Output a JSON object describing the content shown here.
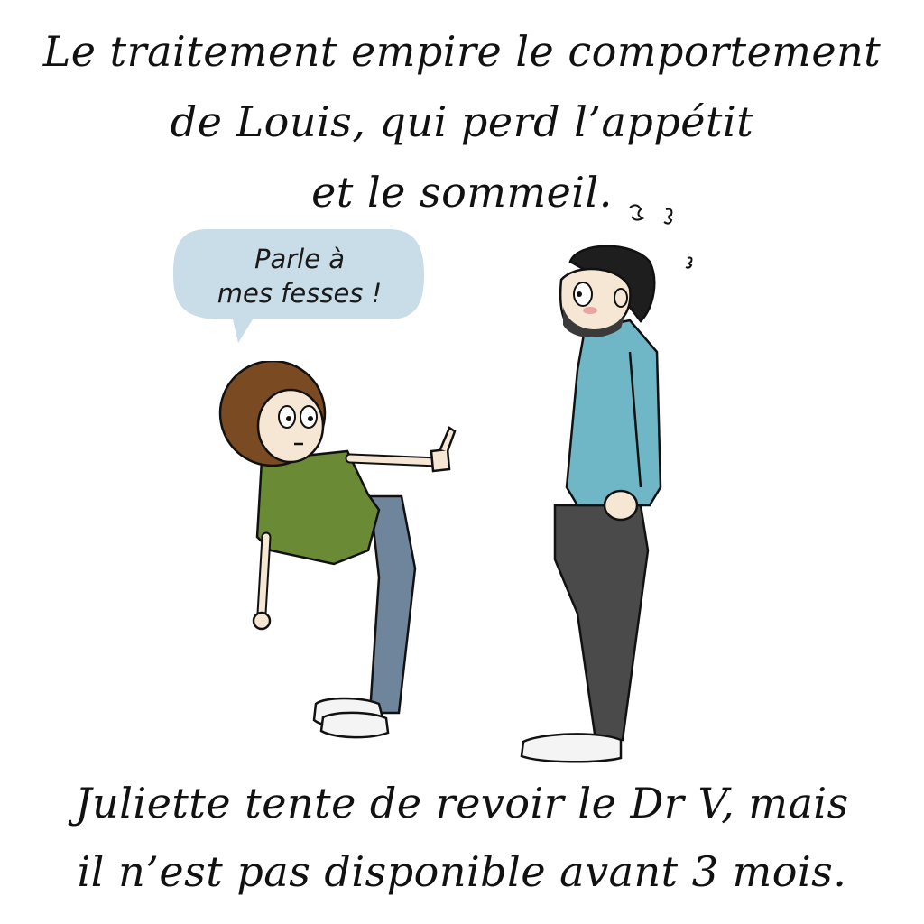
{
  "caption_top": {
    "line1": "Le traitement empire le comportement",
    "line2": "de Louis, qui perd l’appétit",
    "line3": "et le sommeil."
  },
  "speech_bubble": {
    "line1": "Parle à",
    "line2": "mes fesses !"
  },
  "caption_bottom": {
    "line1": "Juliette tente de revoir le Dr V, mais",
    "line2": "il n’est pas disponible avant 3 mois."
  },
  "colors": {
    "bubble_fill": "#c8dde7",
    "child_shirt": "#6b8a35",
    "child_jeans": "#6f859c",
    "child_hair": "#7a4a22",
    "man_sweater": "#6fb6c7",
    "man_pants": "#4a4a4a",
    "man_hair": "#1e1e1e",
    "skin": "#f6e6d4",
    "line": "#111111"
  }
}
